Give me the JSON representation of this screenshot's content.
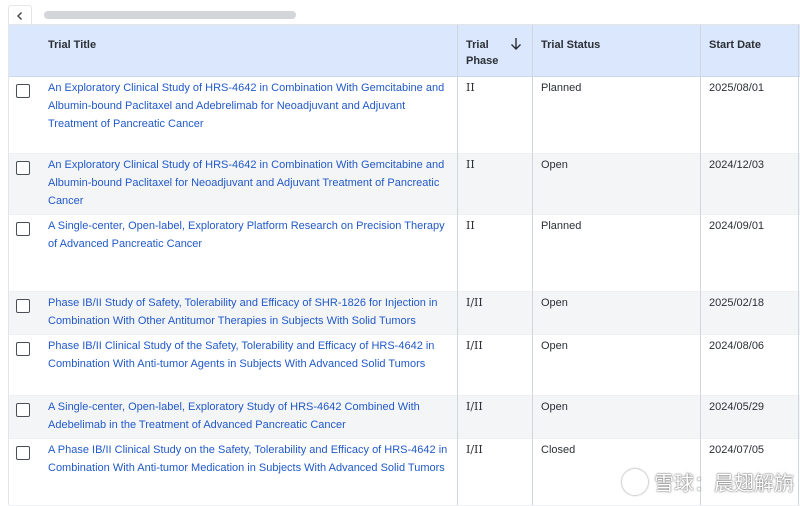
{
  "header": {
    "trial_title": "Trial Title",
    "trial_phase": "Trial\nPhase",
    "trial_phase_line1": "Trial",
    "trial_phase_line2": "Phase",
    "trial_status": "Trial Status",
    "start_date": "Start Date"
  },
  "rows": [
    {
      "title": "An Exploratory Clinical Study of HRS-4642 in Combination With Gemcitabine and Albumin-bound Paclitaxel and Adebrelimab for Neoadjuvant and Adjuvant Treatment of Pancreatic Cancer",
      "phase": "II",
      "status": "Planned",
      "date": "2025/08/01"
    },
    {
      "title": "An Exploratory Clinical Study of HRS-4642 in Combination With Gemcitabine and Albumin-bound Paclitaxel for Neoadjuvant and Adjuvant Treatment of Pancreatic Cancer",
      "phase": "II",
      "status": "Open",
      "date": "2024/12/03"
    },
    {
      "title": "A Single-center, Open-label, Exploratory Platform Research on Precision Therapy of Advanced Pancreatic Cancer",
      "phase": "II",
      "status": "Planned",
      "date": "2024/09/01"
    },
    {
      "title": "Phase IB/II Study of Safety, Tolerability and Efficacy of SHR-1826 for Injection in Combination With Other Antitumor Therapies in Subjects With Solid Tumors",
      "phase": "I/II",
      "status": "Open",
      "date": "2025/02/18"
    },
    {
      "title": "Phase IB/II Clinical Study of the Safety, Tolerability and Efficacy of HRS-4642 in Combination With Anti-tumor Agents in Subjects With Advanced Solid Tumors",
      "phase": "I/II",
      "status": "Open",
      "date": "2024/08/06"
    },
    {
      "title": "A Single-center, Open-label, Exploratory Study of HRS-4642 Combined With Adebelimab in the Treatment of Advanced Pancreatic Cancer",
      "phase": "I/II",
      "status": "Open",
      "date": "2024/05/29"
    },
    {
      "title": "A Phase IB/II Clinical Study on the Safety, Tolerability and Efficacy of HRS-4642 in Combination With Anti-tumor Medication in Subjects With Advanced Solid Tumors",
      "phase": "I/II",
      "status": "Closed",
      "date": "2024/07/05"
    }
  ],
  "watermark": {
    "text": "雪球：晨翅解旃"
  },
  "icons": {
    "back": "chevron-left-icon",
    "sort": "arrow-down-icon",
    "checkbox": "checkbox-icon"
  }
}
